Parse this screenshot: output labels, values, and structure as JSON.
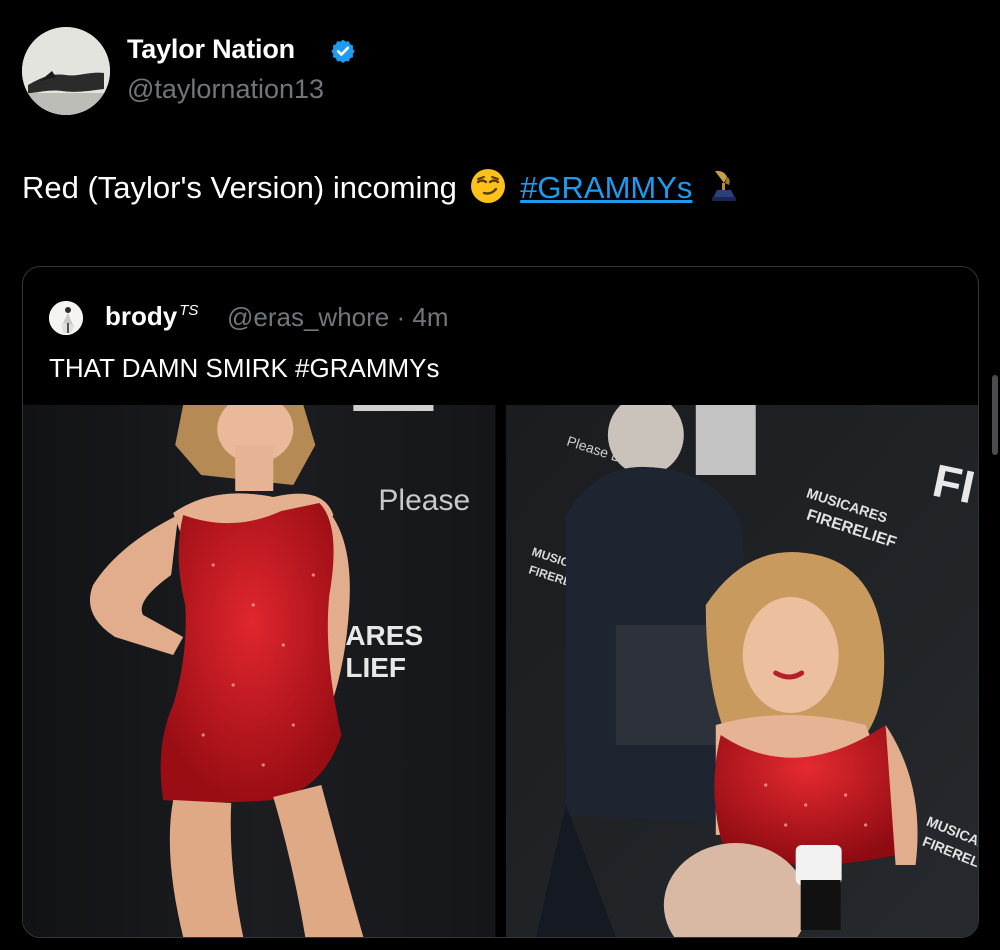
{
  "tweet": {
    "author_name": "Taylor Nation",
    "author_handle": "@taylornation13",
    "verified": true,
    "text_before": "Red (Taylor's Version) incoming",
    "hashtag": "#GRAMMYs",
    "emojis": [
      "smirking-face",
      "gramophone"
    ]
  },
  "quoted_tweet": {
    "author_name": "brody",
    "author_name_suffix": "TS",
    "handle": "@eras_whore",
    "separator": "·",
    "time": "4m",
    "text": "THAT DAMN SMIRK #GRAMMYs",
    "photos": [
      {
        "backdrop_texts": [
          "Please",
          "ARES",
          "LIEF"
        ]
      },
      {
        "backdrop_texts": [
          "Please Donate",
          "MUSICARES",
          "FIRERELIEF",
          "MUSICARES",
          "FIRERELIEF",
          "FI",
          "MUSICARES",
          "FIRERELIEF"
        ]
      }
    ]
  },
  "colors": {
    "background": "#000000",
    "link": "#1d9bf0",
    "muted": "#71767b",
    "border": "#333639",
    "verified_badge": "#1d9bf0",
    "dress_red": "#c4141c"
  }
}
